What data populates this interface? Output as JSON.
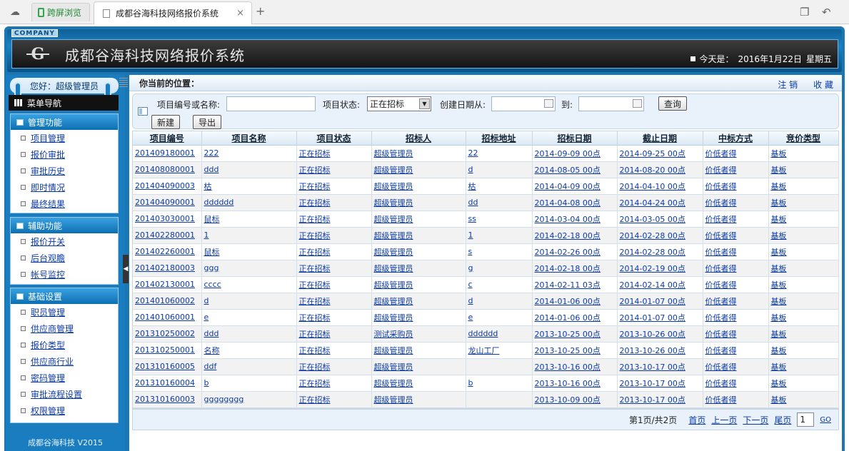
{
  "browser": {
    "tab1_label": "跨屏浏览",
    "tab2_label": "成都谷海科技网络报价系统",
    "close": "×",
    "new_tab": "+"
  },
  "header": {
    "company": "COMPANY",
    "logo": "G",
    "title": "成都谷海科技网络报价系统",
    "today_label": "今天是：",
    "date": "2016年1月22日",
    "weekday": "星期五"
  },
  "sidebar": {
    "greeting": "您好：超级管理员",
    "menu_nav": "菜单导航",
    "groups": [
      {
        "title": "管理功能",
        "items": [
          "项目管理",
          "报价审批",
          "审批历史",
          "即时情况",
          "最终结果"
        ]
      },
      {
        "title": "辅助功能",
        "items": [
          "报价开关",
          "后台观瞻",
          "帐号监控"
        ]
      },
      {
        "title": "基础设置",
        "items": [
          "职员管理",
          "供应商管理",
          "报价类型",
          "供应商行业",
          "密码管理",
          "审批流程设置",
          "权限管理"
        ]
      }
    ],
    "footer": "成都谷海科技 V2015"
  },
  "topbar": {
    "position": "你当前的位置：",
    "logout": "注 销",
    "favorite": "收 藏"
  },
  "search": {
    "id_name_label": "项目编号或名称:",
    "id_name_value": "",
    "status_label": "项目状态:",
    "status_value": "正在招标",
    "created_from_label": "创建日期从:",
    "to_label": "到:",
    "query_button": "查询",
    "new_button": "新建",
    "export_button": "导出"
  },
  "table": {
    "columns": [
      "项目编号",
      "项目名称",
      "项目状态",
      "招标人",
      "招标地址",
      "招标日期",
      "截止日期",
      "中标方式",
      "竞价类型"
    ],
    "rows": [
      [
        "201409180001",
        "222",
        "正在招标",
        "超级管理员",
        "22",
        "2014-09-09 00点",
        "2014-09-25 00点",
        "价低者得",
        "基板"
      ],
      [
        "201408080001",
        "ddd",
        "正在招标",
        "超级管理员",
        "d",
        "2014-08-05 00点",
        "2014-08-20 00点",
        "价低者得",
        "基板"
      ],
      [
        "201404090003",
        "枯",
        "正在招标",
        "超级管理员",
        "枯",
        "2014-04-09 00点",
        "2014-04-10 00点",
        "价低者得",
        "基板"
      ],
      [
        "201404090001",
        "dddddd",
        "正在招标",
        "超级管理员",
        "dd",
        "2014-04-08 00点",
        "2014-04-24 00点",
        "价低者得",
        "基板"
      ],
      [
        "201403030001",
        "鼠标",
        "正在招标",
        "超级管理员",
        "ss",
        "2014-03-04 00点",
        "2014-03-05 00点",
        "价低者得",
        "基板"
      ],
      [
        "201402280001",
        "1",
        "正在招标",
        "超级管理员",
        "1",
        "2014-02-18 00点",
        "2014-02-28 00点",
        "价低者得",
        "基板"
      ],
      [
        "201402260001",
        "鼠标",
        "正在招标",
        "超级管理员",
        "s",
        "2014-02-26 00点",
        "2014-02-28 00点",
        "价低者得",
        "基板"
      ],
      [
        "201402180003",
        "ggg",
        "正在招标",
        "超级管理员",
        "g",
        "2014-02-18 00点",
        "2014-02-19 00点",
        "价低者得",
        "基板"
      ],
      [
        "201402130001",
        "cccc",
        "正在招标",
        "超级管理员",
        "c",
        "2014-02-11 03点",
        "2014-02-14 00点",
        "价低者得",
        "基板"
      ],
      [
        "201401060002",
        "d",
        "正在招标",
        "超级管理员",
        "d",
        "2014-01-06 00点",
        "2014-01-07 00点",
        "价低者得",
        "基板"
      ],
      [
        "201401060001",
        "e",
        "正在招标",
        "超级管理员",
        "e",
        "2014-01-06 00点",
        "2014-01-07 00点",
        "价低者得",
        "基板"
      ],
      [
        "201310250002",
        "ddd",
        "正在招标",
        "测试采购员",
        "dddddd",
        "2013-10-25 00点",
        "2013-10-26 00点",
        "价低者得",
        "基板"
      ],
      [
        "201310250001",
        "名称",
        "正在招标",
        "超级管理员",
        "龙山工厂",
        "2013-10-25 00点",
        "2013-10-26 00点",
        "价低者得",
        "基板"
      ],
      [
        "201310160005",
        "ddf",
        "正在招标",
        "超级管理员",
        "",
        "2013-10-16 00点",
        "2013-10-17 00点",
        "价低者得",
        "基板"
      ],
      [
        "201310160004",
        "b",
        "正在招标",
        "超级管理员",
        "b",
        "2013-10-16 00点",
        "2013-10-17 00点",
        "价低者得",
        "基板"
      ],
      [
        "201310160003",
        "gggggggg",
        "正在招标",
        "超级管理员",
        "",
        "2013-10-09 00点",
        "2013-10-17 00点",
        "价低者得",
        "基板"
      ]
    ]
  },
  "pager": {
    "info": "第1页/共2页",
    "first": "首页",
    "prev": "上一页",
    "next": "下一页",
    "last": "尾页",
    "page_value": "1",
    "go": "GO"
  }
}
